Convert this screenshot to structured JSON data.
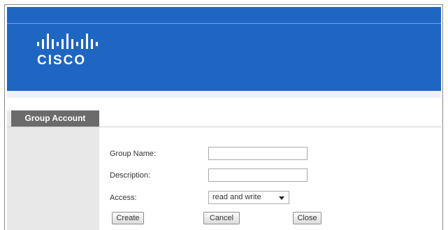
{
  "brand": {
    "logo_text": "CISCO",
    "color": "#1f66c2"
  },
  "sidebar": {
    "active_item": "Group Account"
  },
  "form": {
    "group_name": {
      "label": "Group Name",
      "value": ""
    },
    "description": {
      "label": "Description",
      "value": ""
    },
    "access": {
      "label": "Access",
      "value": "read and write"
    }
  },
  "buttons": {
    "create": "Create",
    "cancel": "Cancel",
    "close": "Close"
  }
}
